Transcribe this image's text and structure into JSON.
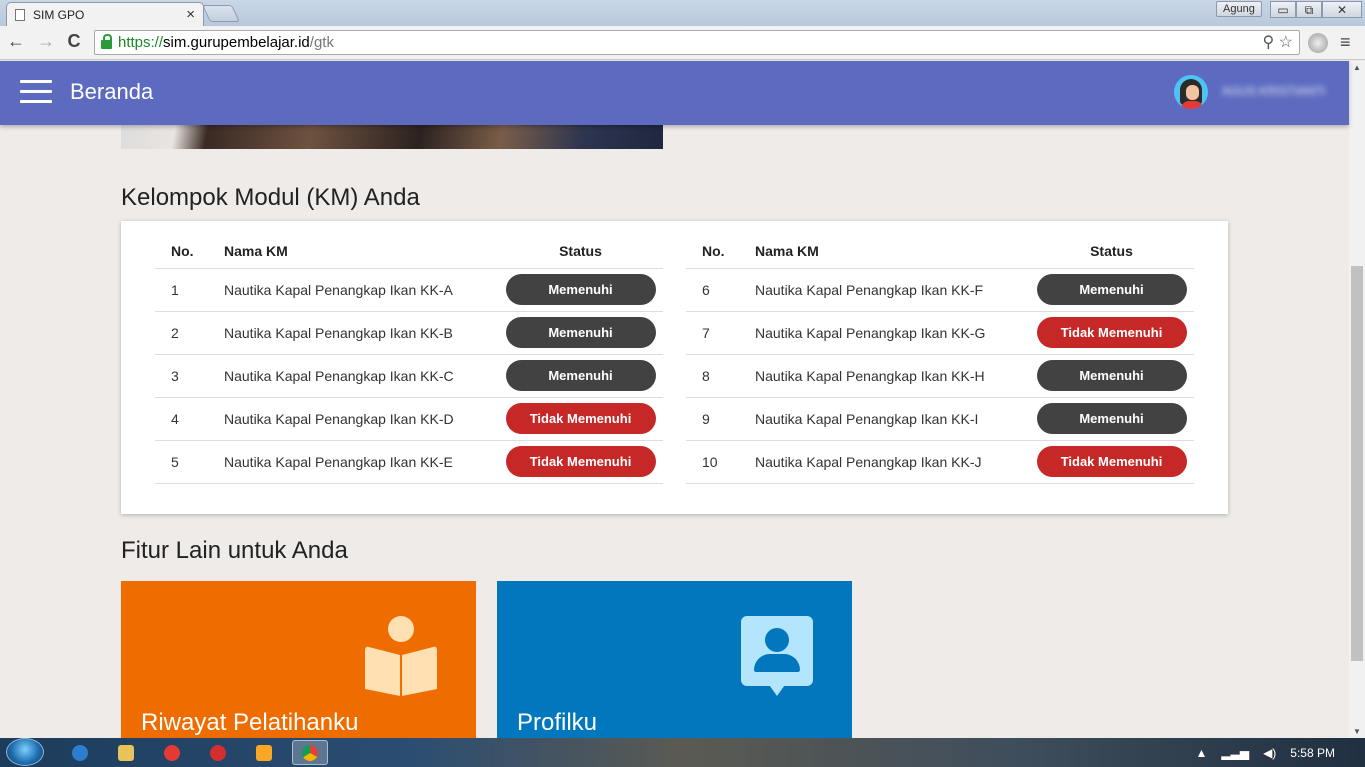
{
  "browser": {
    "tab_title": "SIM GPO",
    "tab_close": "×",
    "user": "Agung",
    "win_minimize": "▭",
    "win_restore": "⧉",
    "win_close": "✕",
    "back": "←",
    "forward": "→",
    "reload": "C",
    "url_scheme": "https://",
    "url_host": "sim.gurupembelajar.id",
    "url_path": "/gtk",
    "omni_icons": "⚲ ☆",
    "menu": "≡"
  },
  "appbar": {
    "title": "Beranda",
    "username": "AGUS KRISTIANTI"
  },
  "km_section": {
    "title": "Kelompok Modul (KM) Anda",
    "headers": {
      "no": "No.",
      "name": "Nama KM",
      "status": "Status"
    },
    "left_rows": [
      {
        "no": "1",
        "name": "Nautika Kapal Penangkap Ikan KK-A",
        "status": "Memenuhi"
      },
      {
        "no": "2",
        "name": "Nautika Kapal Penangkap Ikan KK-B",
        "status": "Memenuhi"
      },
      {
        "no": "3",
        "name": "Nautika Kapal Penangkap Ikan KK-C",
        "status": "Memenuhi"
      },
      {
        "no": "4",
        "name": "Nautika Kapal Penangkap Ikan KK-D",
        "status": "Tidak Memenuhi"
      },
      {
        "no": "5",
        "name": "Nautika Kapal Penangkap Ikan KK-E",
        "status": "Tidak Memenuhi"
      }
    ],
    "right_rows": [
      {
        "no": "6",
        "name": "Nautika Kapal Penangkap Ikan KK-F",
        "status": "Memenuhi"
      },
      {
        "no": "7",
        "name": "Nautika Kapal Penangkap Ikan KK-G",
        "status": "Tidak Memenuhi"
      },
      {
        "no": "8",
        "name": "Nautika Kapal Penangkap Ikan KK-H",
        "status": "Memenuhi"
      },
      {
        "no": "9",
        "name": "Nautika Kapal Penangkap Ikan KK-I",
        "status": "Memenuhi"
      },
      {
        "no": "10",
        "name": "Nautika Kapal Penangkap Ikan KK-J",
        "status": "Tidak Memenuhi"
      }
    ]
  },
  "features": {
    "title": "Fitur Lain untuk Anda",
    "items": [
      {
        "label": "Riwayat Pelatihanku",
        "icon": "reading-book-icon",
        "color": "#ef6c00"
      },
      {
        "label": "Profilku",
        "icon": "profile-icon",
        "color": "#0277bd"
      }
    ]
  },
  "colors": {
    "appbar": "#5c6bc0",
    "status_ok": "#424242",
    "status_fail": "#c62828"
  },
  "taskbar": {
    "clock": "5:58 PM"
  }
}
